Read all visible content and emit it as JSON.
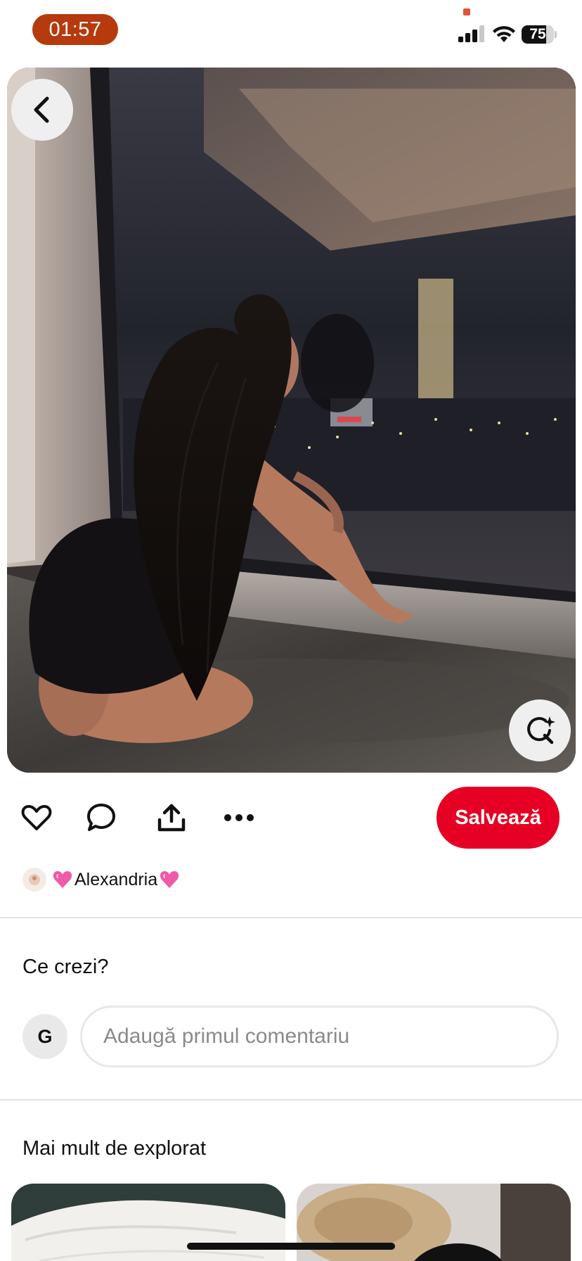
{
  "status_bar": {
    "time": "01:57",
    "battery_level": "75",
    "battery_fraction": 0.75,
    "signal_bars": 3,
    "icons": [
      "cellular-signal-icon",
      "wifi-icon",
      "battery-icon"
    ]
  },
  "pin": {
    "image_icon": "photo",
    "back_icon": "chevron-left-icon",
    "visual_search_icon": "lens-sparkle-icon"
  },
  "actions": {
    "like_icon": "heart-icon",
    "comment_icon": "speech-bubble-icon",
    "share_icon": "share-upload-icon",
    "more_icon": "ellipsis-icon",
    "save_label": "Salvează"
  },
  "creator": {
    "name": "Alexandria"
  },
  "comments": {
    "title": "Ce crezi?",
    "user_initial": "G",
    "placeholder": "Adaugă primul comentariu"
  },
  "explore": {
    "title": "Mai mult de explorat"
  },
  "colors": {
    "accent": "#e60023",
    "time_pill": "#b63a0d",
    "text": "#111111",
    "placeholder": "#8a8a8a",
    "divider": "#e2e2e2"
  }
}
